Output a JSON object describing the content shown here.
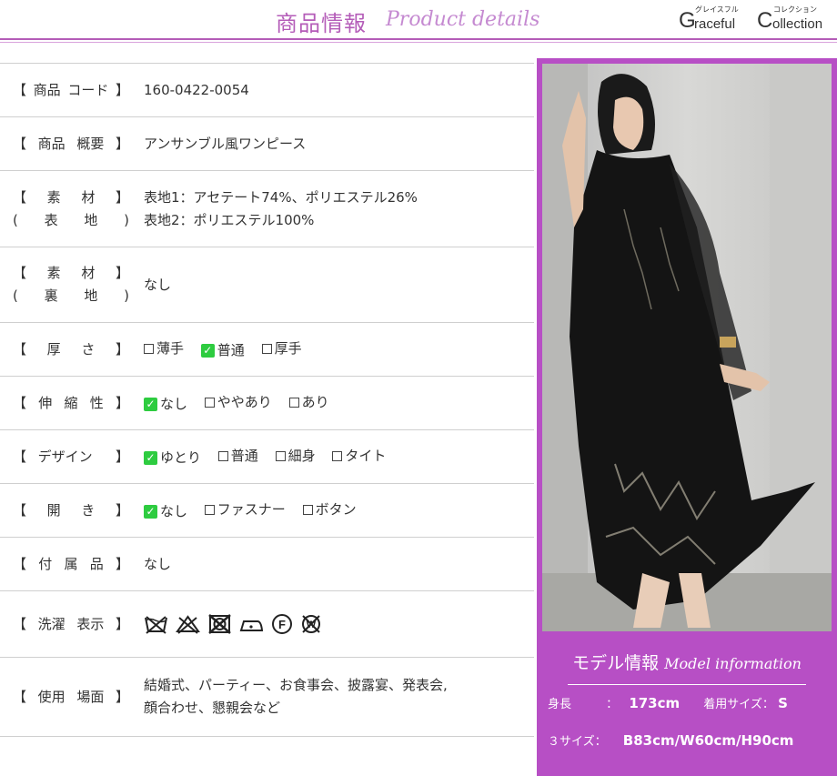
{
  "header": {
    "title_jp": "商品情報",
    "title_en": "Product details",
    "logo": {
      "kana1": "グレイスフル",
      "kana2": "コレクション",
      "g": "G",
      "raceful": "raceful",
      "c": "C",
      "ollection": "ollection"
    }
  },
  "spec": {
    "code": {
      "label": [
        "【",
        "商品",
        "コード",
        "】"
      ],
      "value": "160-0422-0054"
    },
    "summary": {
      "label": [
        "【",
        "商品",
        "概要",
        "】"
      ],
      "value": "アンサンブル風ワンピース"
    },
    "fabric_outer": {
      "label1": [
        "【",
        "素",
        "材",
        "】"
      ],
      "label2": [
        "(",
        "表",
        "地",
        ")"
      ],
      "value1": "表地1：アセテート74%、ポリエステル26%",
      "value2": "表地2：ポリエステル100%"
    },
    "fabric_lining": {
      "label1": [
        "【",
        "素",
        "材",
        "】"
      ],
      "label2": [
        "(",
        "裏",
        "地",
        ")"
      ],
      "value": "なし"
    },
    "thickness": {
      "label": [
        "【",
        "厚",
        "さ",
        "】"
      ],
      "options": [
        "薄手",
        "普通",
        "厚手"
      ]
    },
    "stretch": {
      "label": [
        "【",
        "伸",
        "縮",
        "性",
        "】"
      ],
      "options": [
        "なし",
        "ややあり",
        "あり"
      ]
    },
    "design": {
      "label": [
        "【",
        "デザイン",
        "",
        "】"
      ],
      "options": [
        "ゆとり",
        "普通",
        "細身",
        "タイト"
      ]
    },
    "opening": {
      "label": [
        "【",
        "開",
        "き",
        "】"
      ],
      "options": [
        "なし",
        "ファスナー",
        "ボタン"
      ]
    },
    "accessories": {
      "label": [
        "【",
        "付",
        "属",
        "品",
        "】"
      ],
      "value": "なし"
    },
    "washing": {
      "label": [
        "【",
        "洗濯",
        "表示",
        "】"
      ],
      "icons": [
        "no-wash-icon",
        "no-bleach-icon",
        "no-tumble-dry-icon",
        "iron-low-icon",
        "dry-clean-f-icon",
        "no-wet-clean-icon"
      ]
    },
    "usage": {
      "label": [
        "【",
        "使用",
        "場面",
        "】"
      ],
      "value1": "結婚式、パーティー、お食事会、披露宴、発表会,",
      "value2": "顔合わせ、懇親会など"
    }
  },
  "model": {
    "title_jp": "モデル情報",
    "title_en": "Model information",
    "height_label": "身長",
    "height_sep": "：",
    "height_value": "173cm",
    "size_label": "着用サイズ：",
    "size_value": "S",
    "three_size_label": "３サイズ：",
    "three_size_value": "B83cm/W60cm/H90cm"
  },
  "colors": {
    "accent": "#b45cb8",
    "panel": "#b74fc5",
    "check": "#2ecc40"
  }
}
